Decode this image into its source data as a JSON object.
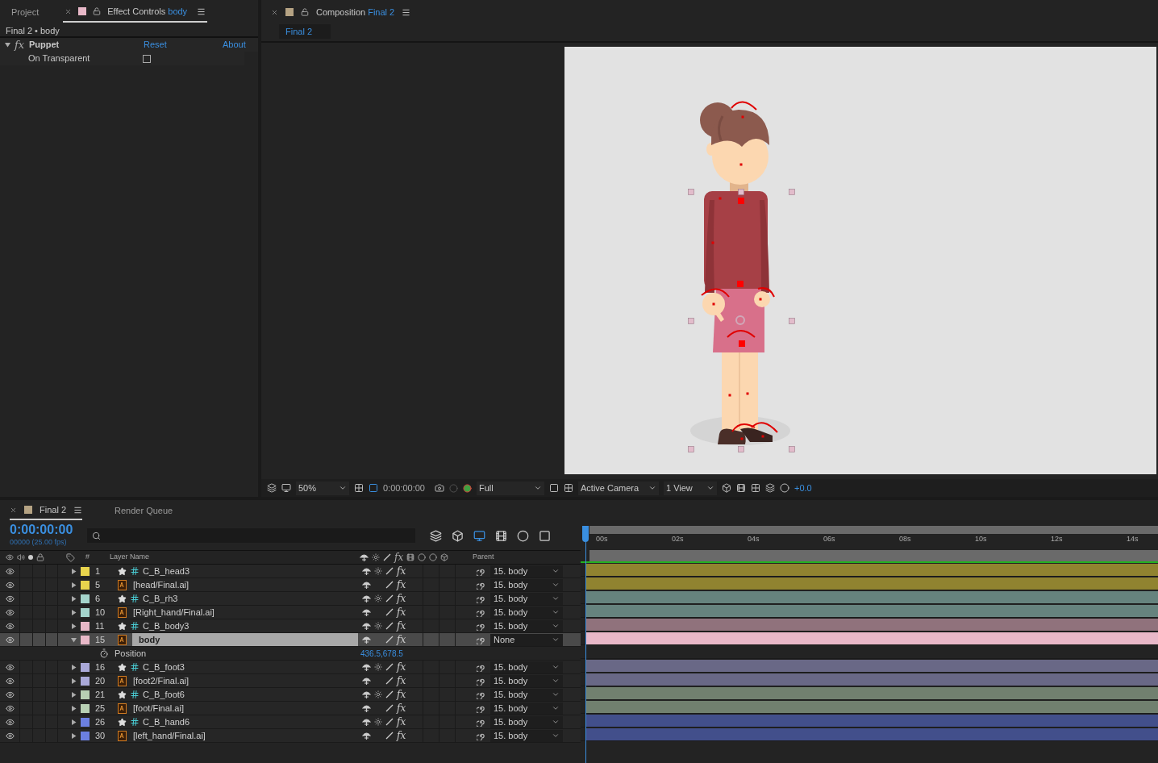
{
  "left_panel": {
    "tabs": [
      {
        "label": "Project",
        "selected": false
      },
      {
        "label": "Effect Controls",
        "target": "body",
        "color": "#e8b8c8",
        "selected": true
      }
    ],
    "breadcrumb": "Final 2 • body",
    "effect": {
      "fx": "fx",
      "name": "Puppet",
      "expanded": true,
      "reset": "Reset",
      "about": "About",
      "properties": [
        {
          "label": "On Transparent",
          "checked": false
        }
      ]
    }
  },
  "composition_panel": {
    "tab": {
      "label": "Composition",
      "target": "Final 2",
      "color": "#b5a383"
    },
    "subtab": "Final 2",
    "viewer_toolbar": {
      "zoom": "50%",
      "timecode": "0:00:00:00",
      "resolution": "Full",
      "camera": "Active Camera",
      "views": "1 View",
      "exposure": "+0.0"
    }
  },
  "timeline": {
    "tabs": [
      {
        "label": "Final 2",
        "color": "#b5a383",
        "selected": true
      },
      {
        "label": "Render Queue",
        "selected": false
      }
    ],
    "timecode": "0:00:00:00",
    "frame_info": "00000 (25.00 fps)",
    "columns": {
      "number": "#",
      "layer_name": "Layer Name",
      "fx": "fx",
      "parent": "Parent"
    },
    "ruler": [
      "00s",
      "02s",
      "04s",
      "06s",
      "08s",
      "10s",
      "12s",
      "14s"
    ],
    "layers": [
      {
        "number": "1",
        "kind": "shape",
        "name": "C_B_head3",
        "color": "#e8d44d",
        "selected": false,
        "expanded": false,
        "fx": "fx",
        "parent": "15. body"
      },
      {
        "number": "5",
        "kind": "illustrator",
        "name": "[head/Final.ai]",
        "color": "#e8d44d",
        "selected": false,
        "expanded": false,
        "fx": "fx",
        "parent": "15. body"
      },
      {
        "number": "6",
        "kind": "shape",
        "name": "C_B_rh3",
        "color": "#a4d4cc",
        "selected": false,
        "expanded": false,
        "fx": "fx",
        "parent": "15. body"
      },
      {
        "number": "10",
        "kind": "illustrator",
        "name": "[Right_hand/Final.ai]",
        "color": "#a4d4cc",
        "selected": false,
        "expanded": false,
        "fx": "fx",
        "parent": "15. body"
      },
      {
        "number": "11",
        "kind": "shape",
        "name": "C_B_body3",
        "color": "#e8b8c8",
        "selected": false,
        "expanded": false,
        "fx": "fx",
        "parent": "15. body"
      },
      {
        "number": "15",
        "kind": "illustrator",
        "name": "body",
        "color": "#e8b8c8",
        "selected": true,
        "expanded": true,
        "fx": "fx",
        "parent": "None",
        "properties": [
          {
            "label": "Position",
            "value": "436.5,678.5"
          }
        ]
      },
      {
        "number": "16",
        "kind": "shape",
        "name": "C_B_foot3",
        "color": "#a9a8d8",
        "selected": false,
        "expanded": false,
        "fx": "fx",
        "parent": "15. body"
      },
      {
        "number": "20",
        "kind": "illustrator",
        "name": "[foot2/Final.ai]",
        "color": "#a9a8d8",
        "selected": false,
        "expanded": false,
        "fx": "fx",
        "parent": "15. body"
      },
      {
        "number": "21",
        "kind": "shape",
        "name": "C_B_foot6",
        "color": "#b7cfb3",
        "selected": false,
        "expanded": false,
        "fx": "fx",
        "parent": "15. body"
      },
      {
        "number": "25",
        "kind": "illustrator",
        "name": "[foot/Final.ai]",
        "color": "#b7cfb3",
        "selected": false,
        "expanded": false,
        "fx": "fx",
        "parent": "15. body"
      },
      {
        "number": "26",
        "kind": "shape",
        "name": "C_B_hand6",
        "color": "#6b7fe0",
        "selected": false,
        "expanded": false,
        "fx": "fx",
        "parent": "15. body"
      },
      {
        "number": "30",
        "kind": "illustrator",
        "name": "[left_hand/Final.ai]",
        "color": "#6b7fe0",
        "selected": false,
        "expanded": false,
        "fx": "fx",
        "parent": "15. body"
      }
    ]
  }
}
